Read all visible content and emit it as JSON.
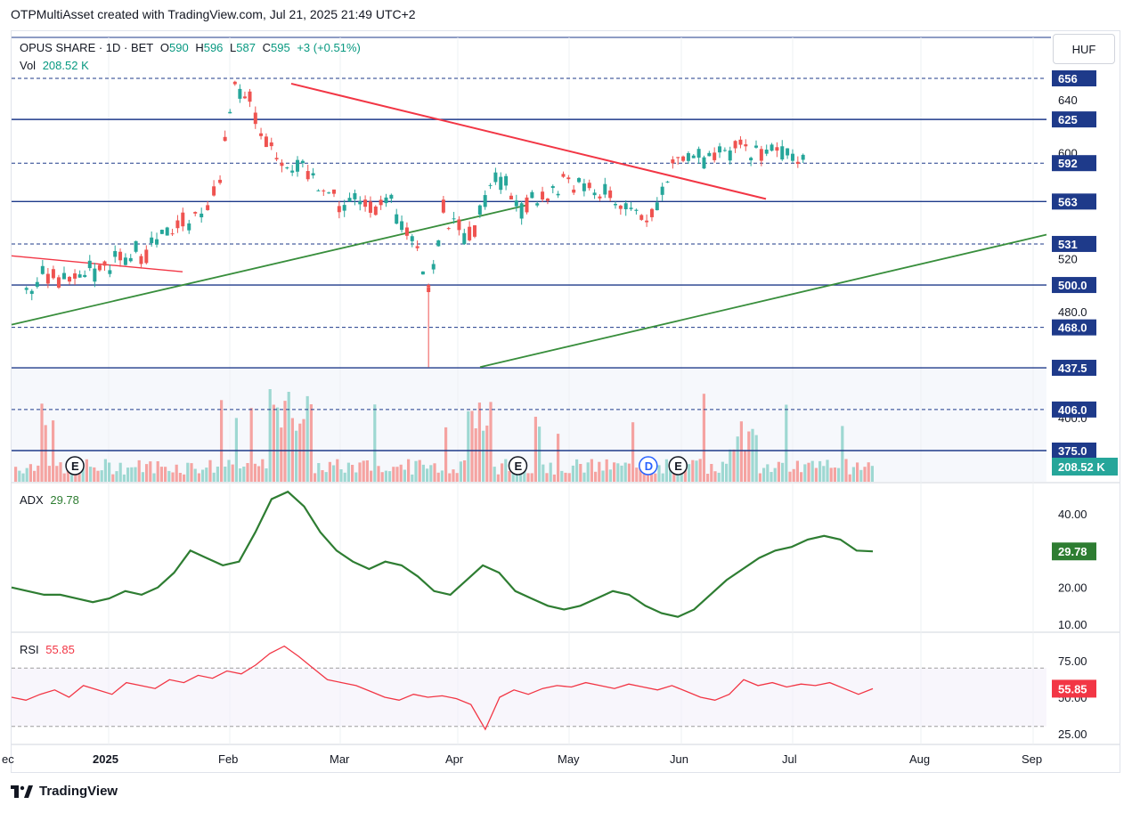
{
  "header": {
    "text": "OTPMultiAsset created with TradingView.com, Jul 21, 2025 21:49 UTC+2"
  },
  "footer": {
    "brand": "TradingView"
  },
  "currency": "HUF",
  "legend": {
    "symbol": "OPUS SHARE · 1D · BET",
    "o_label": "O",
    "o": "590",
    "h_label": "H",
    "h": "596",
    "l_label": "L",
    "l": "587",
    "c_label": "C",
    "c": "595",
    "change": "+3 (+0.51%)",
    "vol_label": "Vol",
    "vol": "208.52 K",
    "adx_label": "ADX",
    "adx": "29.78",
    "rsi_label": "RSI",
    "rsi": "55.85"
  },
  "colors": {
    "up": "#26a69a",
    "down": "#ef5350",
    "level": "#1e3a8a",
    "trend_red": "#f23645",
    "trend_green": "#388e3c",
    "adx": "#2e7d32",
    "rsi": "#f23645"
  },
  "chart_data": {
    "type": "candlestick",
    "x_ticks": [
      "ec",
      "2025",
      "Feb",
      "Mar",
      "Apr",
      "May",
      "Jun",
      "Jul",
      "Aug",
      "Sep"
    ],
    "price_axis_ticks": [
      640,
      600,
      520,
      480.0,
      400.0
    ],
    "levels": [
      {
        "value": 656,
        "label": "656",
        "style": "dashed"
      },
      {
        "value": 625,
        "label": "625",
        "style": "solid"
      },
      {
        "value": 592,
        "label": "592",
        "style": "dashed"
      },
      {
        "value": 563,
        "label": "563",
        "style": "solid"
      },
      {
        "value": 531,
        "label": "531",
        "style": "dashed"
      },
      {
        "value": 500.0,
        "label": "500.0",
        "style": "solid"
      },
      {
        "value": 468.0,
        "label": "468.0",
        "style": "dashed"
      },
      {
        "value": 437.5,
        "label": "437.5",
        "style": "solid"
      },
      {
        "value": 406.0,
        "label": "406.0",
        "style": "dashed"
      },
      {
        "value": 375.0,
        "label": "375.0",
        "style": "solid"
      }
    ],
    "volume_label": "208.52 K",
    "event_markers": [
      {
        "date": "2025-01-02",
        "label": "E"
      },
      {
        "date": "2025-05-01",
        "label": "E"
      },
      {
        "date": "2025-06-05",
        "label": "D"
      },
      {
        "date": "2025-06-13",
        "label": "E"
      }
    ],
    "candles_approx": [
      [
        "2024-12-20",
        503,
        505,
        500,
        502
      ],
      [
        "2025-01-02",
        503,
        510,
        500,
        507
      ],
      [
        "2025-01-10",
        508,
        516,
        504,
        514
      ],
      [
        "2025-01-17",
        514,
        525,
        512,
        522
      ],
      [
        "2025-01-24",
        522,
        532,
        520,
        530
      ],
      [
        "2025-01-31",
        530,
        548,
        528,
        545
      ],
      [
        "2025-02-05",
        545,
        560,
        540,
        555
      ],
      [
        "2025-02-10",
        560,
        590,
        555,
        585
      ],
      [
        "2025-02-14",
        590,
        650,
        585,
        645
      ],
      [
        "2025-02-18",
        645,
        660,
        630,
        640
      ],
      [
        "2025-02-21",
        640,
        645,
        610,
        615
      ],
      [
        "2025-02-28",
        615,
        618,
        590,
        595
      ],
      [
        "2025-03-07",
        595,
        600,
        575,
        580
      ],
      [
        "2025-03-14",
        565,
        575,
        535,
        560
      ],
      [
        "2025-03-21",
        560,
        572,
        550,
        565
      ],
      [
        "2025-03-28",
        565,
        570,
        552,
        558
      ],
      [
        "2025-04-04",
        550,
        555,
        520,
        535
      ],
      [
        "2025-04-07",
        500,
        510,
        438,
        495
      ],
      [
        "2025-04-11",
        510,
        560,
        505,
        555
      ],
      [
        "2025-04-18",
        540,
        550,
        520,
        535
      ],
      [
        "2025-04-25",
        555,
        590,
        550,
        585
      ],
      [
        "2025-05-02",
        575,
        585,
        550,
        560
      ],
      [
        "2025-05-09",
        560,
        575,
        555,
        570
      ],
      [
        "2025-05-16",
        570,
        585,
        565,
        578
      ],
      [
        "2025-05-23",
        575,
        582,
        565,
        572
      ],
      [
        "2025-05-30",
        565,
        575,
        555,
        560
      ],
      [
        "2025-06-06",
        555,
        565,
        545,
        552
      ],
      [
        "2025-06-13",
        560,
        605,
        558,
        598
      ],
      [
        "2025-06-20",
        595,
        605,
        588,
        598
      ],
      [
        "2025-06-27",
        595,
        610,
        590,
        600
      ],
      [
        "2025-07-04",
        598,
        606,
        592,
        603
      ],
      [
        "2025-07-11",
        602,
        606,
        595,
        600
      ],
      [
        "2025-07-18",
        590,
        596,
        587,
        595
      ]
    ],
    "adx": {
      "label": "ADX",
      "value": 29.78,
      "axis_ticks": [
        40.0,
        20.0,
        10.0
      ],
      "series": [
        20,
        19,
        18,
        18,
        17,
        16,
        17,
        19,
        18,
        20,
        24,
        30,
        28,
        26,
        27,
        35,
        44,
        46,
        42,
        35,
        30,
        27,
        25,
        27,
        26,
        23,
        19,
        18,
        22,
        26,
        24,
        19,
        17,
        15,
        14,
        15,
        17,
        19,
        18,
        15,
        13,
        12,
        14,
        18,
        22,
        25,
        28,
        30,
        31,
        33,
        34,
        33,
        30,
        29.78
      ]
    },
    "rsi": {
      "label": "RSI",
      "value": 55.85,
      "axis_ticks": [
        75.0,
        50.0,
        25.0
      ],
      "bands": [
        70,
        30
      ],
      "series": [
        50,
        48,
        52,
        55,
        50,
        58,
        55,
        52,
        60,
        58,
        56,
        62,
        60,
        65,
        63,
        68,
        66,
        72,
        80,
        85,
        78,
        70,
        62,
        60,
        58,
        54,
        50,
        48,
        52,
        50,
        51,
        49,
        45,
        28,
        50,
        55,
        52,
        56,
        58,
        57,
        60,
        58,
        56,
        59,
        57,
        55,
        58,
        54,
        50,
        48,
        52,
        62,
        58,
        60,
        57,
        59,
        58,
        60,
        56,
        52,
        55.85
      ]
    }
  }
}
